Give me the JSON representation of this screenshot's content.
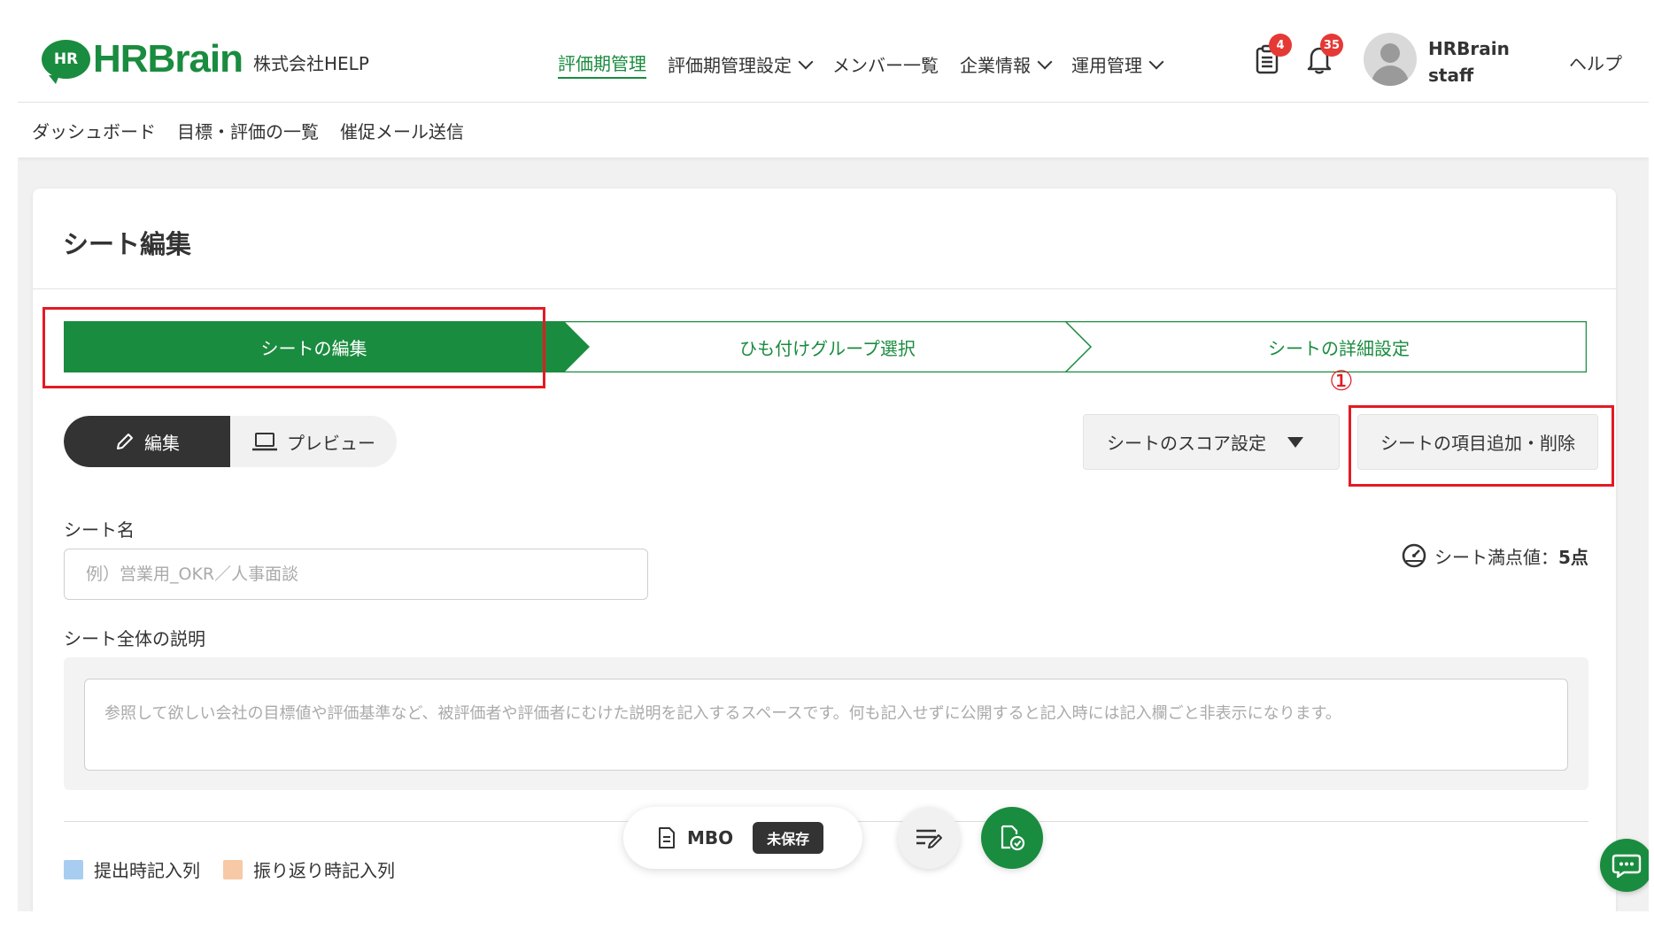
{
  "header": {
    "logo_badge": "HR",
    "logo_text": "HRBrain",
    "company": "株式会社HELP",
    "nav": [
      {
        "label": "評価期管理",
        "active": true,
        "dropdown": false
      },
      {
        "label": "評価期管理設定",
        "active": false,
        "dropdown": true
      },
      {
        "label": "メンバー一覧",
        "active": false,
        "dropdown": false
      },
      {
        "label": "企業情報",
        "active": false,
        "dropdown": true
      },
      {
        "label": "運用管理",
        "active": false,
        "dropdown": true
      }
    ],
    "task_badge": "4",
    "bell_badge": "35",
    "user_name": "HRBrain",
    "user_role": "staff",
    "help": "ヘルプ"
  },
  "subnav": [
    "ダッシュボード",
    "目標・評価の一覧",
    "催促メール送信"
  ],
  "page": {
    "title": "シート編集",
    "steps": [
      "シートの編集",
      "ひも付けグループ選択",
      "シートの詳細設定"
    ],
    "annotation": "①",
    "mode_edit": "編集",
    "mode_preview": "プレビュー",
    "score_setting_button": "シートのスコア設定",
    "add_remove_button": "シートの項目追加・削除",
    "sheet_name_label": "シート名",
    "sheet_name_placeholder": "例）営業用_OKR／人事面談",
    "max_score_label": "シート満点値：",
    "max_score_value": "5点",
    "description_label": "シート全体の説明",
    "description_placeholder": "参照して欲しい会社の目標値や評価基準など、被評価者や評価者にむけた説明を記入するスペースです。何も記入せずに公開すると記入時には記入欄ごと非表示になります。",
    "legend": [
      {
        "label": "提出時記入列",
        "color": "#a8cdf0"
      },
      {
        "label": "振り返り時記入列",
        "color": "#f7c9a6"
      }
    ]
  },
  "floating": {
    "sheet_type": "MBO",
    "status": "未保存"
  },
  "colors": {
    "brand": "#1a8c3f",
    "highlight": "#e31b23"
  }
}
